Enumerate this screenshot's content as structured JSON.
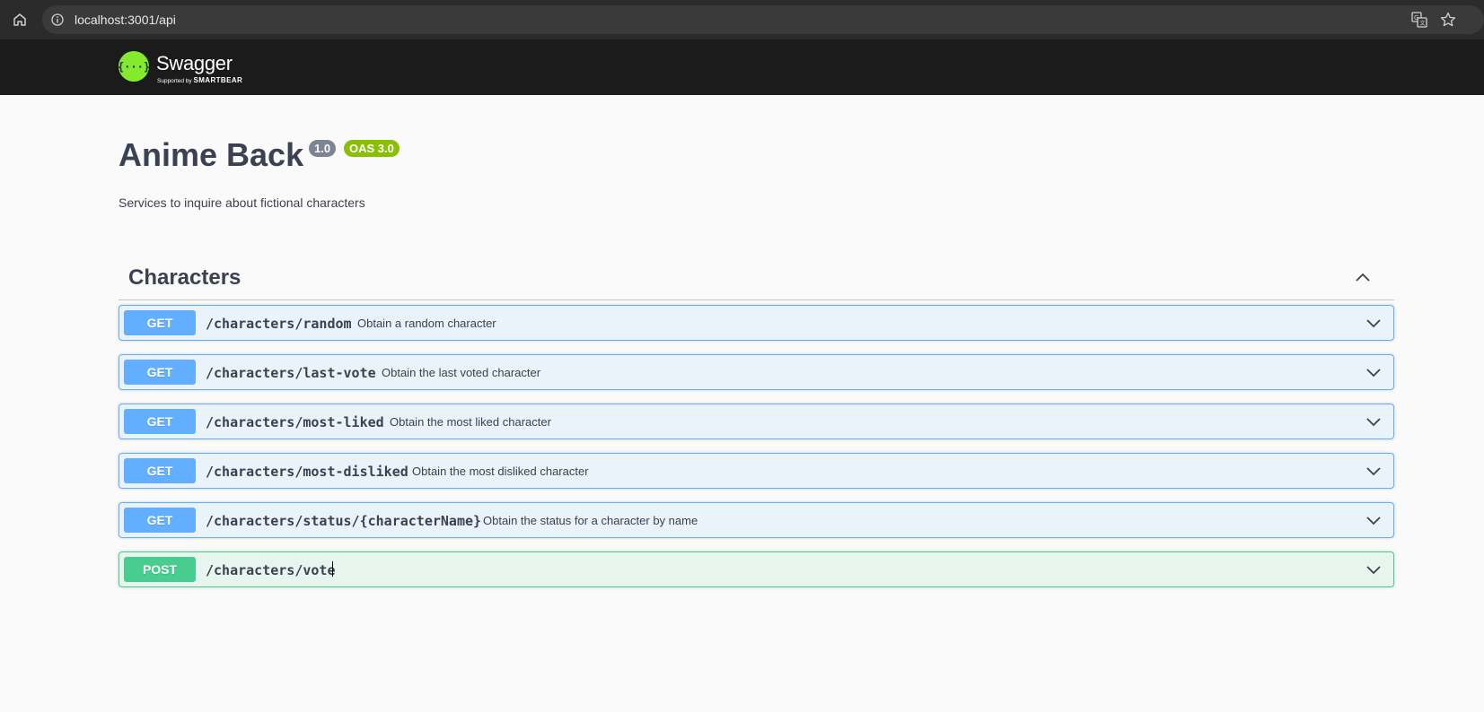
{
  "browser": {
    "url": "localhost:3001/api"
  },
  "topbar": {
    "logo_name": "Swagger",
    "logo_supported_by": "Supported by",
    "logo_company": "SMARTBEAR",
    "logo_glyph": "{···}"
  },
  "info": {
    "title": "Anime Back",
    "version": "1.0",
    "oas": "OAS 3.0",
    "description": "Services to inquire about fictional characters"
  },
  "tag": {
    "name": "Characters"
  },
  "operations": [
    {
      "method": "GET",
      "path": "/characters/random",
      "summary": "Obtain a random character"
    },
    {
      "method": "GET",
      "path": "/characters/last-vote",
      "summary": "Obtain the last voted character"
    },
    {
      "method": "GET",
      "path": "/characters/most-liked",
      "summary": "Obtain the most liked character"
    },
    {
      "method": "GET",
      "path": "/characters/most-disliked",
      "summary": "Obtain the most disliked character"
    },
    {
      "method": "GET",
      "path": "/characters/status/{characterName}",
      "summary": "Obtain the status for a character by name"
    },
    {
      "method": "POST",
      "path": "/characters/vote",
      "summary": ""
    }
  ],
  "colors": {
    "get": "#61affe",
    "post": "#49cc90",
    "badge_version": "#7d8492",
    "badge_oas": "#89bf04",
    "swagger_green": "#85ea2d"
  },
  "icons": {
    "home": "home-icon",
    "info": "info-icon",
    "translate": "translate-icon",
    "star": "star-icon",
    "collapse": "chevron-up-icon",
    "expand": "chevron-down-icon"
  }
}
